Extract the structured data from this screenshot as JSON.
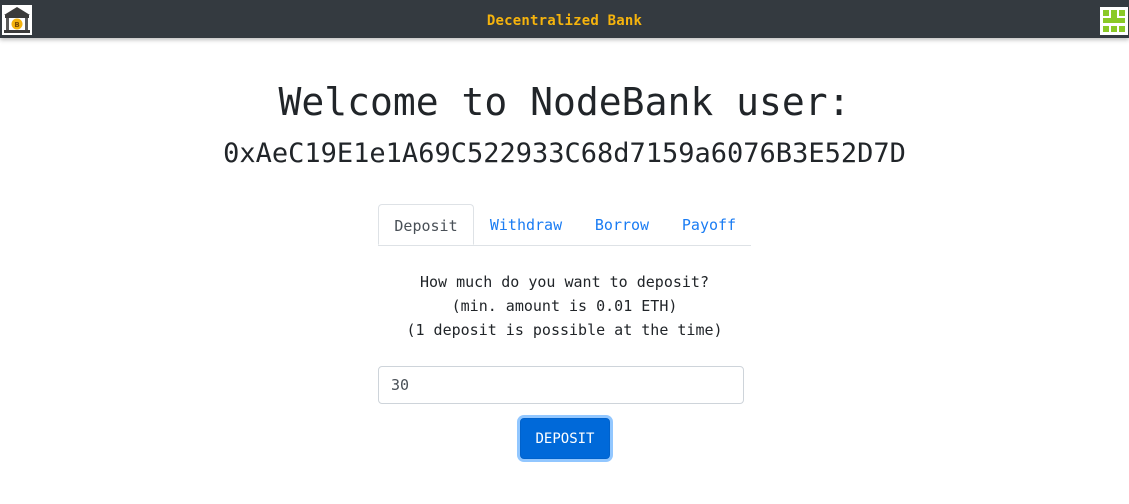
{
  "navbar": {
    "title": "Decentralized Bank",
    "logo_icon": "bank-bitcoin-icon",
    "avatar_icon": "identicon-avatar",
    "colors": {
      "background": "#343a40",
      "title": "#f5b30d"
    }
  },
  "main": {
    "welcome": "Welcome to NodeBank user:",
    "address": "0xAeC19E1e1A69C522933C68d7159a6076B3E52D7D"
  },
  "tabs": [
    {
      "label": "Deposit",
      "active": true
    },
    {
      "label": "Withdraw",
      "active": false
    },
    {
      "label": "Borrow",
      "active": false
    },
    {
      "label": "Payoff",
      "active": false
    }
  ],
  "deposit": {
    "prompt_line1": "How much do you want to deposit?",
    "prompt_line2": "(min. amount is 0.01 ETH)",
    "prompt_line3": "(1 deposit is possible at the time)",
    "input_value": "30",
    "button_label": "DEPOSIT"
  },
  "colors": {
    "link": "#1a7cf3",
    "primary": "#0069d9"
  }
}
